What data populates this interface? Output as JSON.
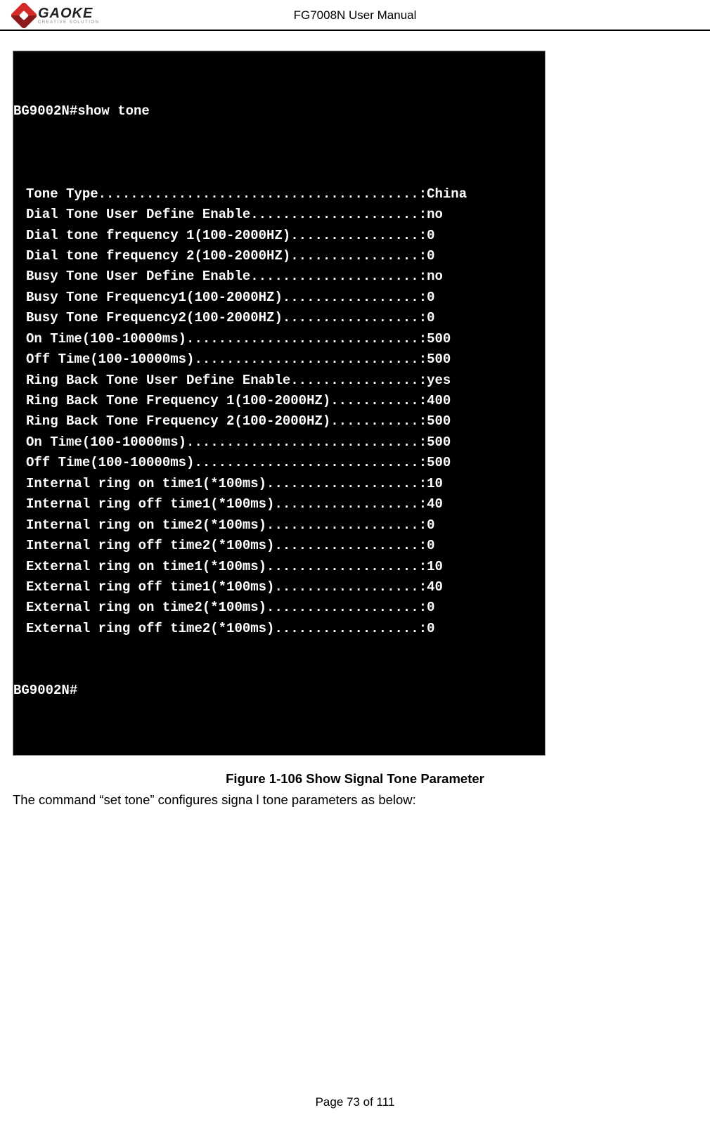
{
  "header": {
    "logo_main": "GAOKE",
    "logo_sub": "CREATIVE SOLUTION",
    "title": "FG7008N User Manual"
  },
  "terminal": {
    "prompt_cmd": "BG9002N#show tone",
    "lines": [
      {
        "label": "Tone Type",
        "dots": "........................................",
        "value": "China"
      },
      {
        "label": "Dial Tone User Define Enable",
        "dots": ".....................",
        "value": "no"
      },
      {
        "label": "Dial tone frequency 1(100-2000HZ)",
        "dots": "................",
        "value": "0"
      },
      {
        "label": "Dial tone frequency 2(100-2000HZ)",
        "dots": "................",
        "value": "0"
      },
      {
        "label": "Busy Tone User Define Enable",
        "dots": ".....................",
        "value": "no"
      },
      {
        "label": "Busy Tone Frequency1(100-2000HZ)",
        "dots": ".................",
        "value": "0"
      },
      {
        "label": "Busy Tone Frequency2(100-2000HZ)",
        "dots": ".................",
        "value": "0"
      },
      {
        "label": "On Time(100-10000ms)",
        "dots": ".............................",
        "value": "500"
      },
      {
        "label": "Off Time(100-10000ms)",
        "dots": "............................",
        "value": "500"
      },
      {
        "label": "Ring Back Tone User Define Enable",
        "dots": "................",
        "value": "yes"
      },
      {
        "label": "Ring Back Tone Frequency 1(100-2000HZ)",
        "dots": "...........",
        "value": "400"
      },
      {
        "label": "Ring Back Tone Frequency 2(100-2000HZ)",
        "dots": "...........",
        "value": "500"
      },
      {
        "label": "On Time(100-10000ms)",
        "dots": ".............................",
        "value": "500"
      },
      {
        "label": "Off Time(100-10000ms)",
        "dots": "............................",
        "value": "500"
      },
      {
        "label": "Internal ring on time1(*100ms)",
        "dots": "...................",
        "value": "10"
      },
      {
        "label": "Internal ring off time1(*100ms)",
        "dots": "..................",
        "value": "40"
      },
      {
        "label": "Internal ring on time2(*100ms)",
        "dots": "...................",
        "value": "0"
      },
      {
        "label": "Internal ring off time2(*100ms)",
        "dots": "..................",
        "value": "0"
      },
      {
        "label": "External ring on time1(*100ms)",
        "dots": "...................",
        "value": "10"
      },
      {
        "label": "External ring off time1(*100ms)",
        "dots": "..................",
        "value": "40"
      },
      {
        "label": "External ring on time2(*100ms)",
        "dots": "...................",
        "value": "0"
      },
      {
        "label": "External ring off time2(*100ms)",
        "dots": "..................",
        "value": "0"
      }
    ],
    "prompt_tail": "BG9002N#"
  },
  "figure": {
    "label": "Figure 1-106",
    "text": "Show Signal Tone Parameter"
  },
  "body_text": "The command “set tone” configures signa l tone parameters as below:",
  "footer": "Page 73 of 111"
}
